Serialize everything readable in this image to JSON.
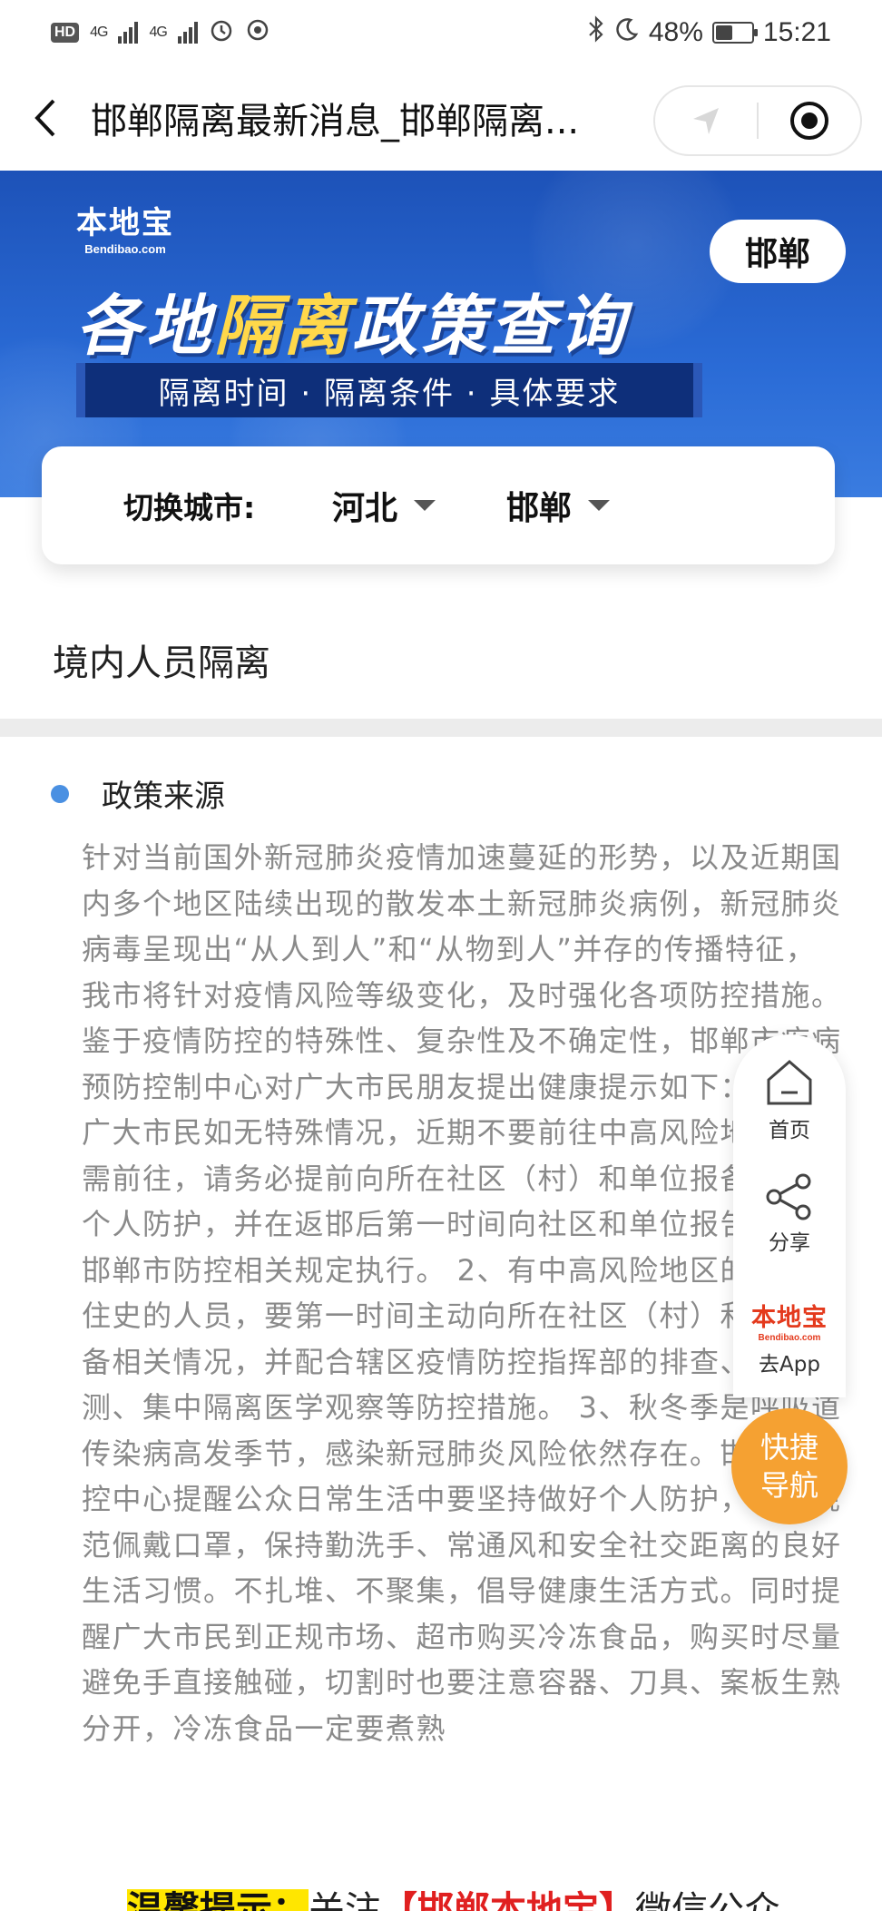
{
  "status_bar": {
    "hd": "HD",
    "sim1": "4G",
    "sim2": "4G",
    "battery_pct": "48%",
    "battery_level": 0.48,
    "time": "15:21"
  },
  "nav": {
    "title": "邯郸隔离最新消息_邯郸隔离...",
    "back_icon": "chevron-left-icon",
    "location_icon": "navigation-arrow-icon",
    "close_icon": "target-circle-icon"
  },
  "banner": {
    "logo_main": "本地宝",
    "logo_sub": "Bendibao.com",
    "city_pill": "邯郸",
    "title_part1": "各地",
    "title_highlight": "隔离",
    "title_part2": "政策查询",
    "strip": "隔离时间 · 隔离条件 · 具体要求",
    "colors": {
      "primary": "#1d52b8",
      "highlight": "#ffd84a"
    }
  },
  "city_switch": {
    "label": "切换城市:",
    "province": "河北",
    "city": "邯郸"
  },
  "section_title": "境内人员隔离",
  "policy": {
    "heading": "政策来源",
    "body": "针对当前国外新冠肺炎疫情加速蔓延的形势，以及近期国内多个地区陆续出现的散发本土新冠肺炎病例，新冠肺炎病毒呈现出“从人到人”和“从物到人”并存的传播特征，我市将针对疫情风险等级变化，及时强化各项防控措施。鉴于疫情防控的特殊性、复杂性及不确定性，邯郸市疾病预防控制中心对广大市民朋友提出健康提示如下： 1、请广大市民如无特殊情况，近期不要前往中高风险地区。如需前往，请务必提前向所在社区（村）和单位报备，做好个人防护，并在返邯后第一时间向社区和单位报告，按照邯郸市防控相关规定执行。 2、有中高风险地区的旅行居住史的人员，要第一时间主动向所在社区（村）和单位报备相关情况，并配合辖区疫情防控指挥部的排查、核酸检测、集中隔离医学观察等防控措施。 3、秋冬季是呼吸道传染病高发季节，感染新冠肺炎风险依然存在。邯郸市疾控中心提醒公众日常生活中要坚持做好个人防护，科学规范佩戴口罩，保持勤洗手、常通风和安全社交距离的良好生活习惯。不扎堆、不聚集，倡导健康生活方式。同时提醒广大市民到正规市场、超市购买冷冻食品，购买时尽量避免手直接触碰，切割时也要注意容器、刀具、案板生熟分开，冷冻食品一定要煮熟"
  },
  "tip": {
    "label": "温馨提示：",
    "mid": "关注",
    "red": "【邯郸本地宝】",
    "end": "微信公众"
  },
  "side_panel": {
    "home_label": "首页",
    "home_icon": "home-icon",
    "share_label": "分享",
    "share_icon": "share-icon",
    "app_logo": "本地宝",
    "app_logo_sub": "Bendibao.com",
    "app_label": "去App",
    "quick_line1": "快捷",
    "quick_line2": "导航",
    "quick_color": "#f5a132"
  }
}
